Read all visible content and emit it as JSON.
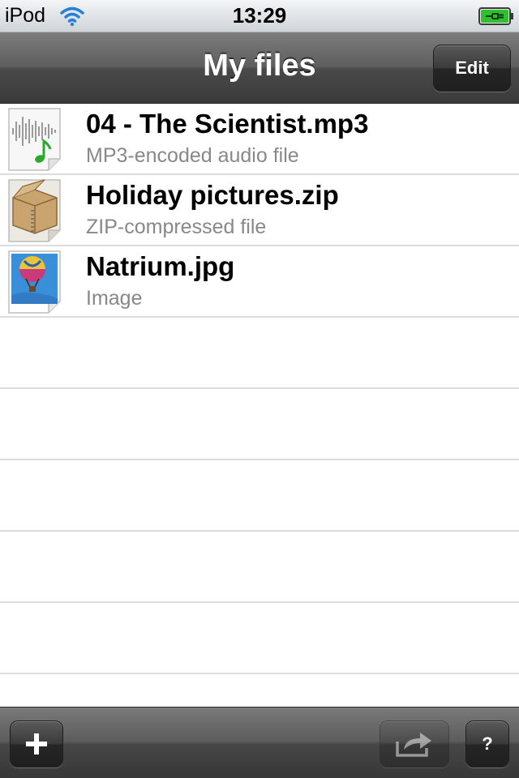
{
  "status_bar": {
    "carrier": "iPod",
    "time": "13:29",
    "wifi_icon": "wifi-icon",
    "battery_icon": "battery-charging-icon",
    "battery_color": "#2fbf2f"
  },
  "nav": {
    "title": "My files",
    "edit_label": "Edit"
  },
  "files": [
    {
      "name": "04 - The Scientist.mp3",
      "type": "MP3-encoded audio file",
      "icon": "audio-file-icon"
    },
    {
      "name": "Holiday pictures.zip",
      "type": "ZIP-compressed file",
      "icon": "zip-file-icon"
    },
    {
      "name": "Natrium.jpg",
      "type": "Image",
      "icon": "image-file-icon"
    }
  ],
  "toolbar": {
    "add_icon": "plus-icon",
    "share_icon": "share-icon",
    "share_enabled": false,
    "help_label": "?"
  }
}
